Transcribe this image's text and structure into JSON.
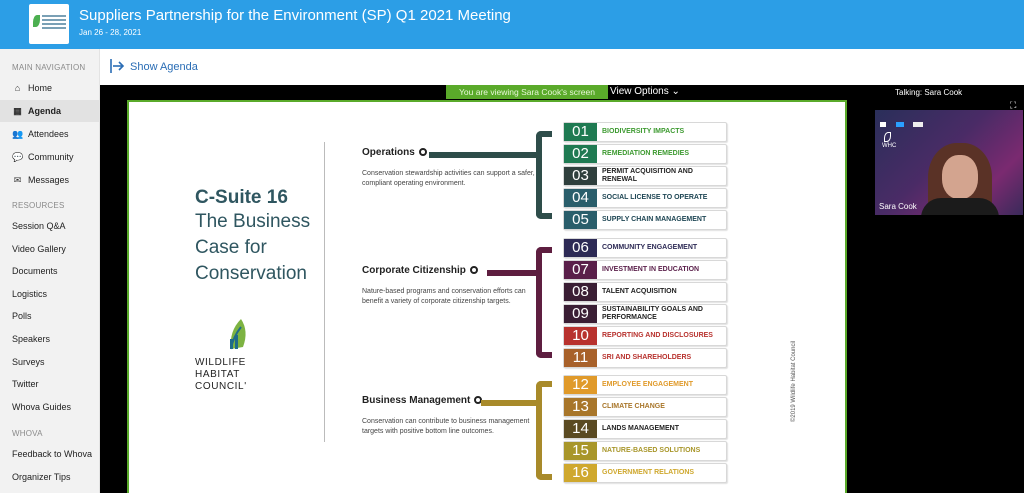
{
  "header": {
    "title": "Suppliers Partnership for the Environment (SP) Q1 2021 Meeting",
    "date": "Jan 26 - 28, 2021"
  },
  "sidebar": {
    "sections": {
      "main": "MAIN NAVIGATION",
      "resources": "RESOURCES",
      "whova": "WHOVA"
    },
    "main_items": [
      {
        "label": "Home",
        "icon": "home-icon",
        "glyph": "⌂"
      },
      {
        "label": "Agenda",
        "icon": "calendar-icon",
        "glyph": "▦",
        "active": true
      },
      {
        "label": "Attendees",
        "icon": "users-icon",
        "glyph": "👥"
      },
      {
        "label": "Community",
        "icon": "chat-icon",
        "glyph": "💬"
      },
      {
        "label": "Messages",
        "icon": "envelope-icon",
        "glyph": "✉"
      }
    ],
    "resource_items": [
      "Session Q&A",
      "Video Gallery",
      "Documents",
      "Logistics",
      "Polls",
      "Speakers",
      "Surveys",
      "Twitter",
      "Whova Guides"
    ],
    "whova_items": [
      "Feedback to Whova",
      "Organizer Tips"
    ]
  },
  "agenda_bar": {
    "label": "Show Agenda"
  },
  "screen_share": {
    "viewing_text": "You are viewing Sara Cook's screen",
    "view_options": "View Options ⌄",
    "talking": "Talking: Sara Cook"
  },
  "video": {
    "speaker": "Sara Cook",
    "logo_text": "WHC"
  },
  "slide": {
    "title": "C-Suite 16",
    "subtitle": "The Business Case for Conservation",
    "logo_lines": [
      "WILDLIFE",
      "HABITAT",
      "COUNCIL'"
    ],
    "copyright": "©2019 Wildlife Habitat Council",
    "colors": {
      "operations": "#2e4d4a",
      "citizenship": "#5e1e40",
      "business": "#a88a2a"
    },
    "groups": [
      {
        "title": "Operations",
        "desc": "Conservation stewardship activities can support a safer, compliant operating environment."
      },
      {
        "title": "Corporate Citizenship",
        "desc": "Nature-based programs and conservation efforts can benefit a variety of corporate citizenship targets."
      },
      {
        "title": "Business Management",
        "desc": "Conservation can contribute to business management targets with positive bottom line outcomes."
      }
    ],
    "items": [
      {
        "num": "01",
        "label": "BIODIVERSITY IMPACTS",
        "bg": "#1f7a52",
        "fg": "#3d9a30"
      },
      {
        "num": "02",
        "label": "REMEDIATION REMEDIES",
        "bg": "#1f7a52",
        "fg": "#3d9a30"
      },
      {
        "num": "03",
        "label": "PERMIT ACQUISITION AND RENEWAL",
        "bg": "#2f3f3d",
        "fg": "#222222"
      },
      {
        "num": "04",
        "label": "SOCIAL LICENSE TO OPERATE",
        "bg": "#2a5e6b",
        "fg": "#1e4654"
      },
      {
        "num": "05",
        "label": "SUPPLY CHAIN MANAGEMENT",
        "bg": "#2a5e6b",
        "fg": "#1e4654"
      },
      {
        "num": "06",
        "label": "COMMUNITY ENGAGEMENT",
        "bg": "#2d2a55",
        "fg": "#2d2a55"
      },
      {
        "num": "07",
        "label": "INVESTMENT IN EDUCATION",
        "bg": "#5a1f4a",
        "fg": "#5a1f4a"
      },
      {
        "num": "08",
        "label": "TALENT ACQUISITION",
        "bg": "#3a1e34",
        "fg": "#222222"
      },
      {
        "num": "09",
        "label": "SUSTAINABILITY GOALS AND PERFORMANCE",
        "bg": "#3a1e34",
        "fg": "#222222"
      },
      {
        "num": "10",
        "label": "REPORTING AND DISCLOSURES",
        "bg": "#b8322e",
        "fg": "#b8322e"
      },
      {
        "num": "11",
        "label": "SRI AND SHAREHOLDERS",
        "bg": "#a8612a",
        "fg": "#b8322e"
      },
      {
        "num": "12",
        "label": "EMPLOYEE ENGAGEMENT",
        "bg": "#e09a2a",
        "fg": "#e09a2a"
      },
      {
        "num": "13",
        "label": "CLIMATE CHANGE",
        "bg": "#a8762a",
        "fg": "#a8762a"
      },
      {
        "num": "14",
        "label": "LANDS MANAGEMENT",
        "bg": "#5a4a22",
        "fg": "#222222"
      },
      {
        "num": "15",
        "label": "NATURE-BASED SOLUTIONS",
        "bg": "#a8962a",
        "fg": "#a8962a"
      },
      {
        "num": "16",
        "label": "GOVERNMENT RELATIONS",
        "bg": "#cfa82e",
        "fg": "#cfa82e"
      }
    ]
  }
}
